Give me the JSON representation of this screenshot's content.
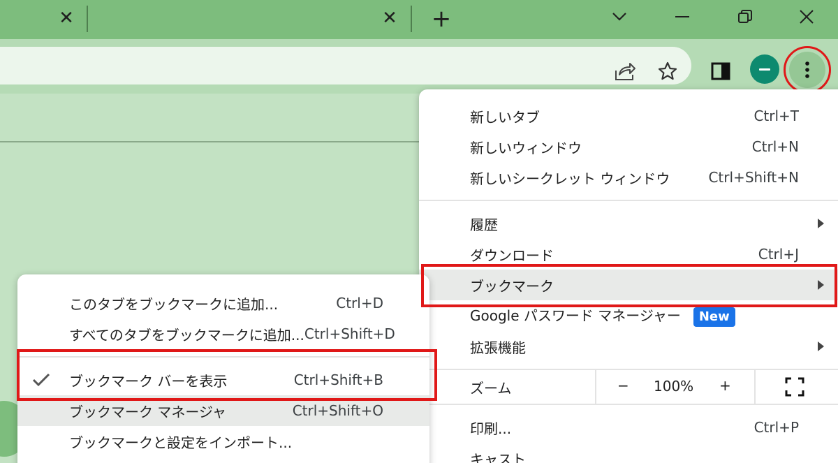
{
  "tabs": {
    "close_glyph": "✕",
    "new_tab_glyph": "+"
  },
  "main_menu": {
    "items_group1": [
      {
        "label": "新しいタブ",
        "shortcut": "Ctrl+T"
      },
      {
        "label": "新しいウィンドウ",
        "shortcut": "Ctrl+N"
      },
      {
        "label": "新しいシークレット ウィンドウ",
        "shortcut": "Ctrl+Shift+N"
      }
    ],
    "history": {
      "label": "履歴"
    },
    "downloads": {
      "label": "ダウンロード",
      "shortcut": "Ctrl+J"
    },
    "bookmarks": {
      "label": "ブックマーク"
    },
    "password_manager": {
      "label": "Google パスワード マネージャー",
      "badge": "New"
    },
    "extensions": {
      "label": "拡張機能"
    },
    "zoom": {
      "label": "ズーム",
      "minus": "−",
      "value": "100%",
      "plus": "+"
    },
    "print": {
      "label": "印刷...",
      "shortcut": "Ctrl+P"
    },
    "cast": {
      "label": "キャスト"
    }
  },
  "bookmark_submenu": {
    "items": [
      {
        "label": "このタブをブックマークに追加...",
        "shortcut": "Ctrl+D"
      },
      {
        "label": "すべてのタブをブックマークに追加...",
        "shortcut": "Ctrl+Shift+D"
      }
    ],
    "show_bar": {
      "label": "ブックマーク バーを表示",
      "shortcut": "Ctrl+Shift+B",
      "checked": true
    },
    "manager": {
      "label": "ブックマーク マネージャ",
      "shortcut": "Ctrl+Shift+O"
    },
    "import": {
      "label": "ブックマークと設定をインポート..."
    }
  },
  "colors": {
    "accent_red": "#e01818",
    "badge_blue": "#1a73e8",
    "profile_green": "#0d8a6f",
    "titlebar_green": "#7dbd7d"
  }
}
